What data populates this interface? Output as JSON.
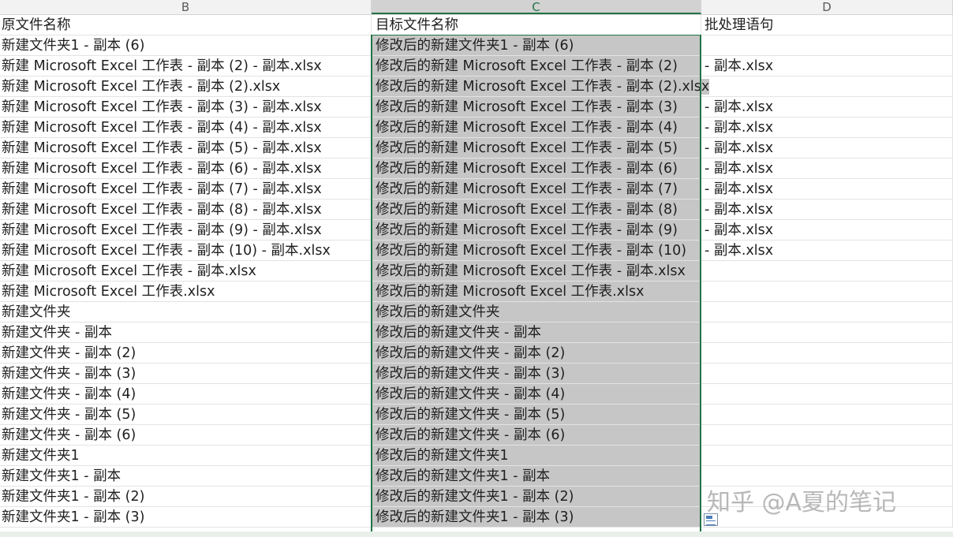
{
  "columns": [
    {
      "letter": "B"
    },
    {
      "letter": "C",
      "selected": true
    },
    {
      "letter": "D"
    }
  ],
  "headers": {
    "b": "原文件名称",
    "c": "目标文件名称",
    "d": "批处理语句"
  },
  "rows": [
    {
      "b": "新建文件夹1 - 副本 (6)",
      "c": "修改后的新建文件夹1 - 副本 (6)",
      "d": ""
    },
    {
      "b": "新建 Microsoft Excel 工作表 - 副本 (2) - 副本.xlsx",
      "c": "修改后的新建 Microsoft Excel 工作表 - 副本 (2)",
      "d": "- 副本.xlsx"
    },
    {
      "b": "新建 Microsoft Excel 工作表 - 副本 (2).xlsx",
      "c": "修改后的新建 Microsoft Excel 工作表 - 副本 (2).xlsx",
      "d": ""
    },
    {
      "b": "新建 Microsoft Excel 工作表 - 副本 (3) - 副本.xlsx",
      "c": "修改后的新建 Microsoft Excel 工作表 - 副本 (3)",
      "d": "- 副本.xlsx"
    },
    {
      "b": "新建 Microsoft Excel 工作表 - 副本 (4) - 副本.xlsx",
      "c": "修改后的新建 Microsoft Excel 工作表 - 副本 (4)",
      "d": "- 副本.xlsx"
    },
    {
      "b": "新建 Microsoft Excel 工作表 - 副本 (5) - 副本.xlsx",
      "c": "修改后的新建 Microsoft Excel 工作表 - 副本 (5)",
      "d": "- 副本.xlsx"
    },
    {
      "b": "新建 Microsoft Excel 工作表 - 副本 (6) - 副本.xlsx",
      "c": "修改后的新建 Microsoft Excel 工作表 - 副本 (6)",
      "d": "- 副本.xlsx"
    },
    {
      "b": "新建 Microsoft Excel 工作表 - 副本 (7) - 副本.xlsx",
      "c": "修改后的新建 Microsoft Excel 工作表 - 副本 (7)",
      "d": "- 副本.xlsx"
    },
    {
      "b": "新建 Microsoft Excel 工作表 - 副本 (8) - 副本.xlsx",
      "c": "修改后的新建 Microsoft Excel 工作表 - 副本 (8)",
      "d": "- 副本.xlsx"
    },
    {
      "b": "新建 Microsoft Excel 工作表 - 副本 (9) - 副本.xlsx",
      "c": "修改后的新建 Microsoft Excel 工作表 - 副本 (9)",
      "d": "- 副本.xlsx"
    },
    {
      "b": "新建 Microsoft Excel 工作表 - 副本 (10) - 副本.xlsx",
      "c": "修改后的新建 Microsoft Excel 工作表 - 副本 (10)",
      "d": "- 副本.xlsx"
    },
    {
      "b": "新建 Microsoft Excel 工作表 - 副本.xlsx",
      "c": "修改后的新建 Microsoft Excel 工作表 - 副本.xlsx",
      "d": ""
    },
    {
      "b": "新建 Microsoft Excel 工作表.xlsx",
      "c": "修改后的新建 Microsoft Excel 工作表.xlsx",
      "d": ""
    },
    {
      "b": "新建文件夹",
      "c": "修改后的新建文件夹",
      "d": ""
    },
    {
      "b": "新建文件夹 - 副本",
      "c": "修改后的新建文件夹 - 副本",
      "d": ""
    },
    {
      "b": "新建文件夹 - 副本 (2)",
      "c": "修改后的新建文件夹 - 副本 (2)",
      "d": ""
    },
    {
      "b": "新建文件夹 - 副本 (3)",
      "c": "修改后的新建文件夹 - 副本 (3)",
      "d": ""
    },
    {
      "b": "新建文件夹 - 副本 (4)",
      "c": "修改后的新建文件夹 - 副本 (4)",
      "d": ""
    },
    {
      "b": "新建文件夹 - 副本 (5)",
      "c": "修改后的新建文件夹 - 副本 (5)",
      "d": ""
    },
    {
      "b": "新建文件夹 - 副本 (6)",
      "c": "修改后的新建文件夹 - 副本 (6)",
      "d": ""
    },
    {
      "b": "新建文件夹1",
      "c": "修改后的新建文件夹1",
      "d": ""
    },
    {
      "b": "新建文件夹1 - 副本",
      "c": "修改后的新建文件夹1 - 副本",
      "d": ""
    },
    {
      "b": "新建文件夹1 - 副本 (2)",
      "c": "修改后的新建文件夹1 - 副本 (2)",
      "d": ""
    },
    {
      "b": "新建文件夹1 - 副本 (3)",
      "c": "修改后的新建文件夹1 - 副本 (3)",
      "d": ""
    }
  ],
  "watermark": "知乎 @A夏的笔记",
  "icons": {
    "quick_analysis": "quick-analysis-icon"
  }
}
